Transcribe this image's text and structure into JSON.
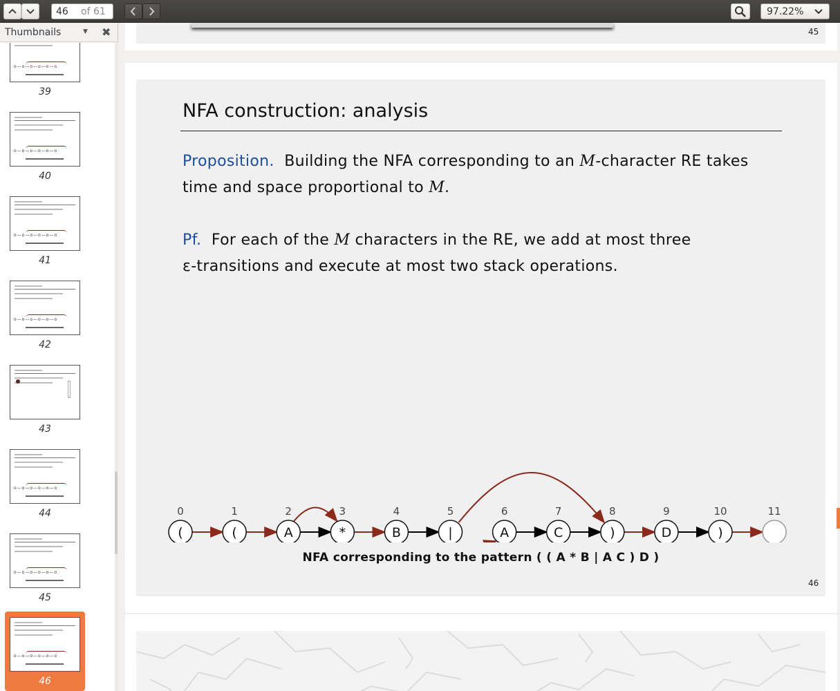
{
  "toolbar": {
    "page_current": "46",
    "page_total": "of 61",
    "zoom": "97.22%"
  },
  "sidebar": {
    "title": "Thumbnails",
    "thumbnails": [
      {
        "num": "39"
      },
      {
        "num": "40"
      },
      {
        "num": "41"
      },
      {
        "num": "42"
      },
      {
        "num": "43"
      },
      {
        "num": "44"
      },
      {
        "num": "45"
      },
      {
        "num": "46",
        "selected": true
      }
    ]
  },
  "prev_page": {
    "number": "45"
  },
  "slide": {
    "title": "NFA construction:  analysis",
    "prop_label": "Proposition.",
    "prop_text_1": "Building the NFA corresponding to an ",
    "prop_M": "M",
    "prop_text_2": "-character RE takes",
    "prop_line2_a": "time and space proportional to ",
    "prop_line2_M": "M",
    "prop_line2_b": ".",
    "pf_label": "Pf.",
    "pf_text_1": "For each of the ",
    "pf_M": "M",
    "pf_text_2": " characters in the RE, we add at most three",
    "pf_line2": "ε-transitions and execute at most two stack operations.",
    "caption": "NFA corresponding to the pattern ( ( A * B | A C ) D )",
    "page_number": "46",
    "nfa": {
      "states": [
        {
          "index": "0",
          "char": "("
        },
        {
          "index": "1",
          "char": "("
        },
        {
          "index": "2",
          "char": "A"
        },
        {
          "index": "3",
          "char": "*"
        },
        {
          "index": "4",
          "char": "B"
        },
        {
          "index": "5",
          "char": "|"
        },
        {
          "index": "6",
          "char": "A"
        },
        {
          "index": "7",
          "char": "C"
        },
        {
          "index": "8",
          "char": ")"
        },
        {
          "index": "9",
          "char": "D"
        },
        {
          "index": "10",
          "char": ")"
        },
        {
          "index": "11",
          "char": ""
        }
      ],
      "edge_colors": {
        "epsilon": "#8b2a1c",
        "match": "#000000"
      }
    }
  }
}
